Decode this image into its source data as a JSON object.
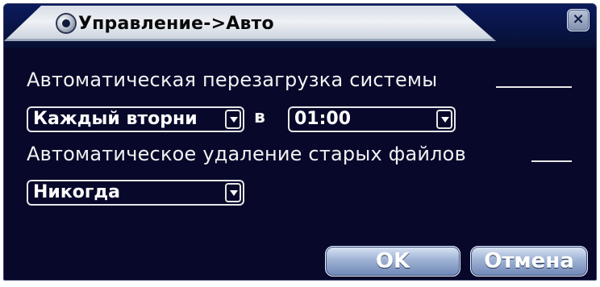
{
  "dialog": {
    "title": "Управление->Авто",
    "close_symbol": "×"
  },
  "auto_reboot": {
    "label": "Автоматическая перезагрузка системы",
    "day_value": "Каждый вторни",
    "at_label": "в",
    "time_value": "01:00"
  },
  "auto_delete": {
    "label": "Автоматическое удаление старых файлов",
    "value": "Никогда"
  },
  "buttons": {
    "ok_label": "OK",
    "cancel_label": "Отмена"
  }
}
